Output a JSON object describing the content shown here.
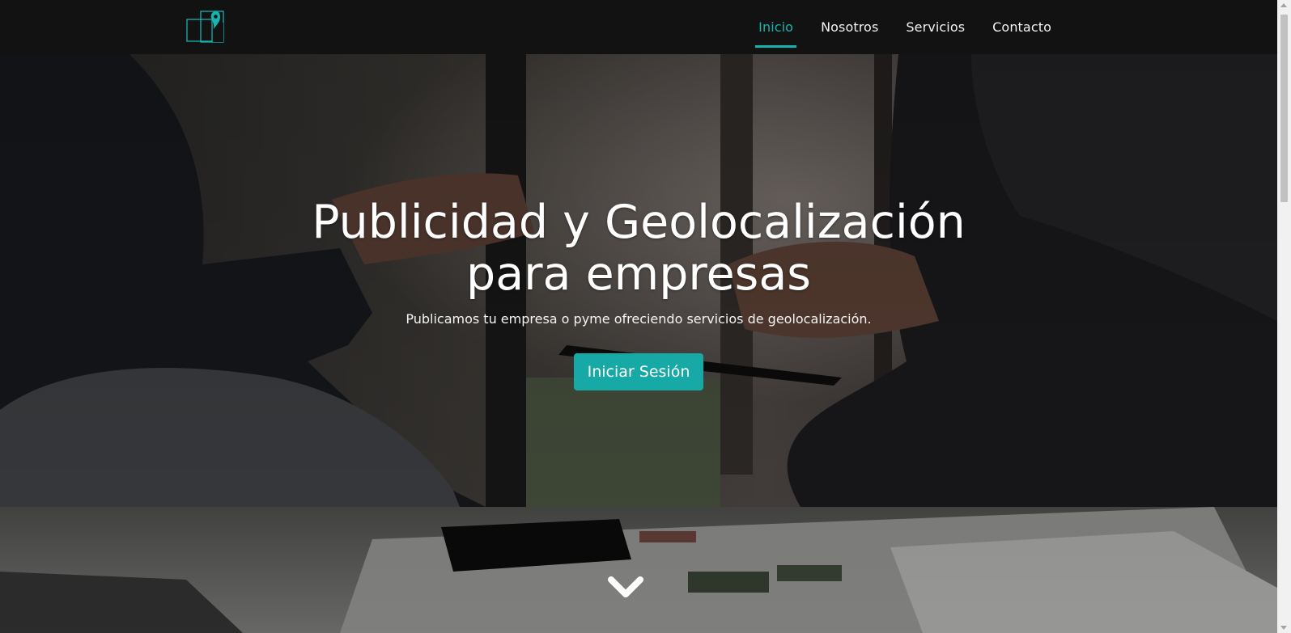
{
  "nav": {
    "items": [
      {
        "label": "Inicio",
        "active": true
      },
      {
        "label": "Nosotros",
        "active": false
      },
      {
        "label": "Servicios",
        "active": false
      },
      {
        "label": "Contacto",
        "active": false
      }
    ]
  },
  "hero": {
    "title": "Publicidad y Geolocalización para empresas",
    "subtitle": "Publicamos tu empresa o pyme ofreciendo servicios de geolocalización.",
    "button_label": "Iniciar Sesión",
    "scroll_icon": "chevron-down-icon"
  },
  "colors": {
    "accent": "#17b3b0",
    "button": "#17a9a6",
    "navbar": "#121212"
  }
}
